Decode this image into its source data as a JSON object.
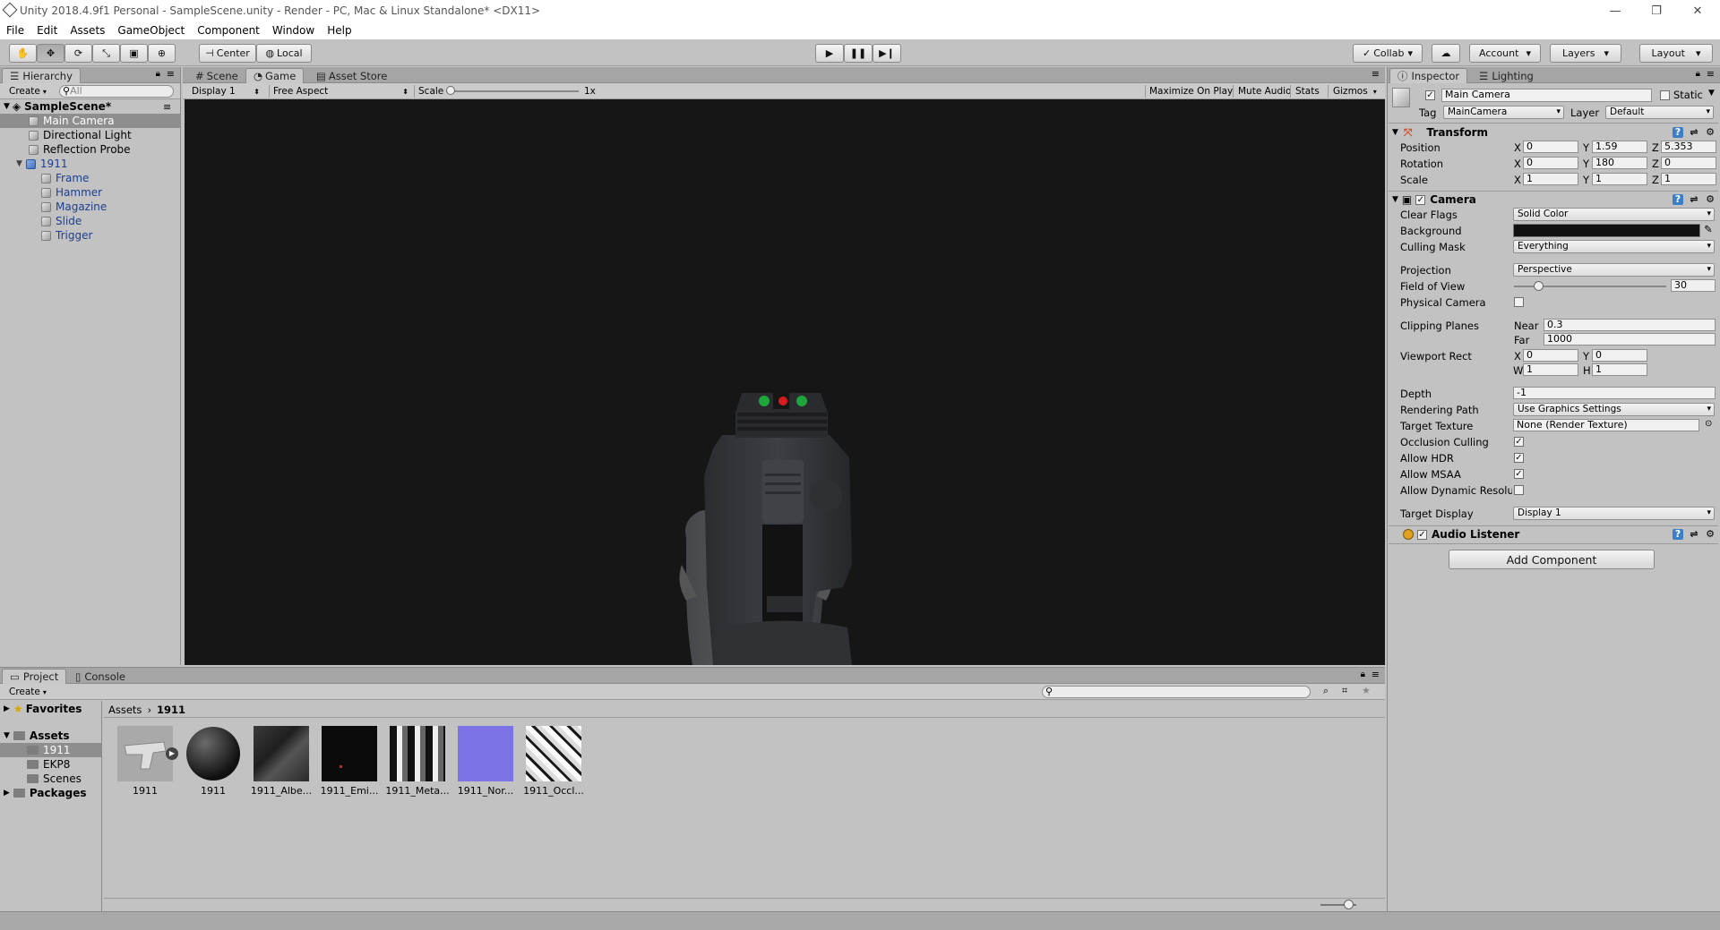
{
  "window": {
    "title": "Unity 2018.4.9f1 Personal - SampleScene.unity - Render - PC, Mac & Linux Standalone* <DX11>"
  },
  "menu": [
    "File",
    "Edit",
    "Assets",
    "GameObject",
    "Component",
    "Window",
    "Help"
  ],
  "toolbar": {
    "pivot": "Center",
    "space": "Local",
    "collab": "Collab",
    "account": "Account",
    "layers": "Layers",
    "layout": "Layout"
  },
  "hierarchy": {
    "tab": "Hierarchy",
    "create": "Create",
    "search_placeholder": "All",
    "scene": "SampleScene*",
    "items": [
      {
        "label": "Main Camera",
        "selected": true
      },
      {
        "label": "Directional Light"
      },
      {
        "label": "Reflection Probe"
      },
      {
        "label": "1911",
        "prefab": true
      },
      {
        "label": "Frame"
      },
      {
        "label": "Hammer"
      },
      {
        "label": "Magazine"
      },
      {
        "label": "Slide"
      },
      {
        "label": "Trigger"
      }
    ]
  },
  "game_view": {
    "tabs": [
      "Scene",
      "Game",
      "Asset Store"
    ],
    "display": "Display 1",
    "aspect": "Free Aspect",
    "scale_label": "Scale",
    "scale_value": "1x",
    "scale_fraction": 0.0,
    "buttons": [
      "Maximize On Play",
      "Mute Audio",
      "Stats",
      "Gizmos"
    ]
  },
  "inspector": {
    "tabs": [
      "Inspector",
      "Lighting"
    ],
    "object_name": "Main Camera",
    "static_label": "Static",
    "tag_label": "Tag",
    "tag": "MainCamera",
    "layer_label": "Layer",
    "layer": "Default",
    "transform": {
      "title": "Transform",
      "position_label": "Position",
      "position": {
        "x": "0",
        "y": "1.59",
        "z": "5.353"
      },
      "rotation_label": "Rotation",
      "rotation": {
        "x": "0",
        "y": "180",
        "z": "0"
      },
      "scale_label": "Scale",
      "scale": {
        "x": "1",
        "y": "1",
        "z": "1"
      }
    },
    "camera": {
      "title": "Camera",
      "clear_flags_label": "Clear Flags",
      "clear_flags": "Solid Color",
      "background_label": "Background",
      "background_color": "#111111",
      "culling_mask_label": "Culling Mask",
      "culling_mask": "Everything",
      "projection_label": "Projection",
      "projection": "Perspective",
      "fov_label": "Field of View",
      "fov": "30",
      "fov_fraction": 0.16,
      "physical_label": "Physical Camera",
      "clipping_label": "Clipping Planes",
      "near_label": "Near",
      "near": "0.3",
      "far_label": "Far",
      "far": "1000",
      "viewport_label": "Viewport Rect",
      "vx": "0",
      "vy": "0",
      "vw": "1",
      "vh": "1",
      "depth_label": "Depth",
      "depth": "-1",
      "render_path_label": "Rendering Path",
      "render_path": "Use Graphics Settings",
      "target_texture_label": "Target Texture",
      "target_texture": "None (Render Texture)",
      "occlusion_label": "Occlusion Culling",
      "hdr_label": "Allow HDR",
      "msaa_label": "Allow MSAA",
      "dynres_label": "Allow Dynamic Resolu",
      "target_display_label": "Target Display",
      "target_display": "Display 1"
    },
    "audio_listener": {
      "title": "Audio Listener"
    },
    "add_component": "Add Component"
  },
  "project": {
    "tabs": [
      "Project",
      "Console"
    ],
    "create": "Create",
    "favorites": "Favorites",
    "assets": "Assets",
    "folders": [
      "1911",
      "EKP8",
      "Scenes"
    ],
    "packages": "Packages",
    "breadcrumb": [
      "Assets",
      "1911"
    ],
    "items": [
      "1911",
      "1911",
      "1911_Albe...",
      "1911_Emi...",
      "1911_Meta...",
      "1911_Nor...",
      "1911_Occl..."
    ]
  },
  "colors": {
    "editor_bg": "#c2c2c2",
    "selection": "#8e8e8e",
    "prefab_blue": "#1d3f8f",
    "game_bg": "#161616"
  }
}
